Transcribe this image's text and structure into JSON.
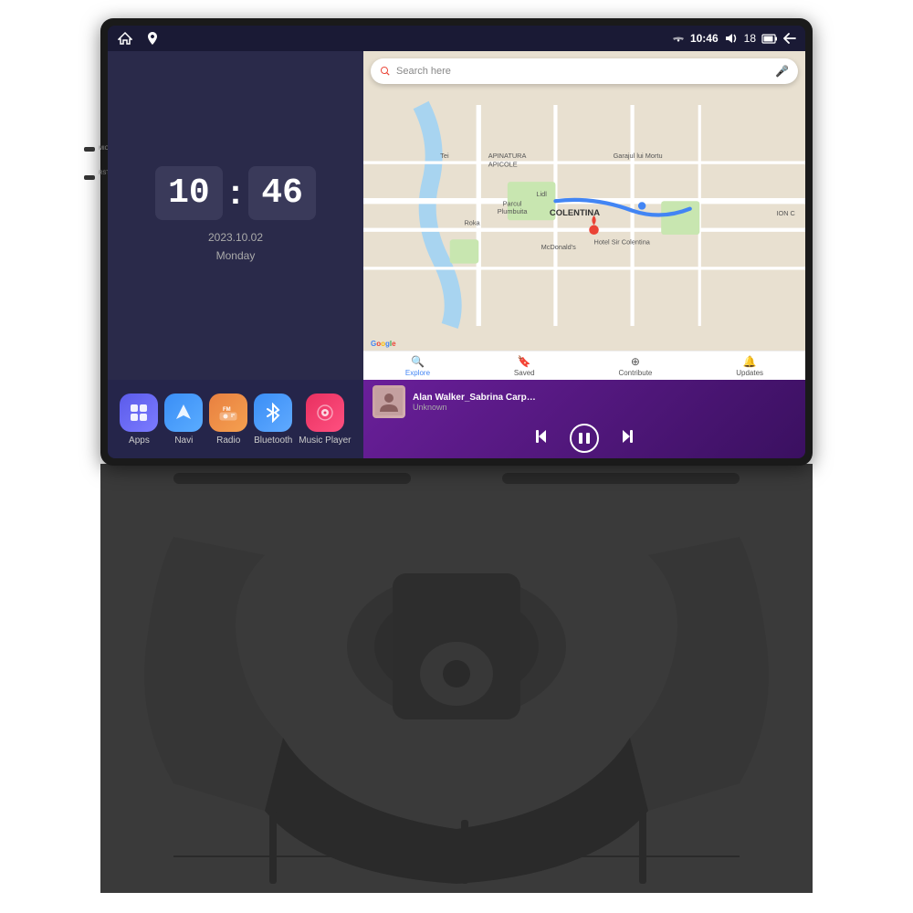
{
  "device": {
    "title": "Car Android Head Unit"
  },
  "status_bar": {
    "time": "10:46",
    "volume": "18",
    "nav_labels": [
      "home",
      "map-pin",
      "wifi",
      "volume",
      "battery",
      "back"
    ]
  },
  "clock": {
    "hour": "10",
    "minute": "46",
    "date": "2023.10.02",
    "day": "Monday"
  },
  "map": {
    "search_placeholder": "Search here",
    "bottom_items": [
      {
        "label": "Explore",
        "active": true
      },
      {
        "label": "Saved",
        "active": false
      },
      {
        "label": "Contribute",
        "active": false
      },
      {
        "label": "Updates",
        "active": false
      }
    ],
    "places": [
      "APINATURA APICOLE",
      "Garajul lui Mortu",
      "McDonald's",
      "Hotel Sir Colentina",
      "COLENTINA",
      "ION C"
    ],
    "google_text": "Google"
  },
  "apps": [
    {
      "id": "apps",
      "label": "Apps",
      "icon_class": "icon-apps",
      "symbol": "⊞"
    },
    {
      "id": "navi",
      "label": "Navi",
      "icon_class": "icon-navi",
      "symbol": "▲"
    },
    {
      "id": "radio",
      "label": "Radio",
      "icon_class": "icon-radio",
      "symbol": "📻"
    },
    {
      "id": "bluetooth",
      "label": "Bluetooth",
      "icon_class": "icon-bluetooth",
      "symbol": "⚡"
    },
    {
      "id": "music",
      "label": "Music Player",
      "icon_class": "icon-music",
      "symbol": "♪"
    }
  ],
  "music": {
    "title": "Alan Walker_Sabrina Carpenter_F...",
    "artist": "Unknown",
    "controls": {
      "prev": "⏮",
      "play": "⏸",
      "next": "⏭"
    }
  },
  "side_buttons": [
    {
      "label": "MIC"
    },
    {
      "label": "RST"
    }
  ]
}
